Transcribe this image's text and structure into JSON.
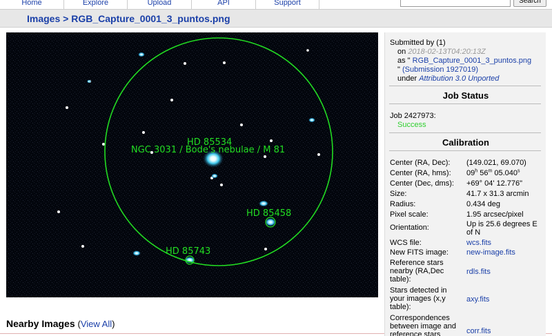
{
  "nav": {
    "home": "Home",
    "explore": "Explore",
    "upload": "Upload",
    "api": "API",
    "support": "Support",
    "search_button": "Search"
  },
  "breadcrumb": {
    "root": "Images",
    "separator": ">",
    "current": "RGB_Capture_0001_3_puntos.png"
  },
  "image": {
    "annotations": {
      "hd85534": "HD 85534",
      "ngc3031": "NGC 3031 / Bode's nebulae / M 81",
      "hd85458": "HD 85458",
      "hd85743": "HD 85743"
    },
    "annotation_color": "#22dd22"
  },
  "submission": {
    "submitted_by": "Submitted by (1)",
    "on_label": "on",
    "date": "2018-02-13T04:20:13Z",
    "as_prefix": "as \"",
    "filename": "RGB_Capture_0001_3_puntos.png",
    "quote_close": "\"",
    "submission_link": "(Submission 1927019)",
    "under_label": "under",
    "license": "Attribution 3.0 Unported"
  },
  "job_status": {
    "title": "Job Status",
    "job_label": "Job 2427973:",
    "status": "Success"
  },
  "calibration": {
    "title": "Calibration",
    "center_radec_label": "Center (RA, Dec):",
    "center_radec_value": "(149.021, 69.070)",
    "center_hms_label": "Center (RA, hms):",
    "ra_h": "09",
    "ra_m": "56",
    "ra_s": "05.040",
    "center_dms_label": "Center (Dec, dms):",
    "center_dms_value": "+69° 04' 12.776\"",
    "size_label": "Size:",
    "size_value": "41.7 x 31.3 arcmin",
    "radius_label": "Radius:",
    "radius_value": "0.434 deg",
    "pixel_scale_label": "Pixel scale:",
    "pixel_scale_value": "1.95 arcsec/pixel",
    "orientation_label": "Orientation:",
    "orientation_value": "Up is 25.6 degrees E of N",
    "wcs_label": "WCS file:",
    "wcs_value": "wcs.fits",
    "new_fits_label": "New FITS image:",
    "new_fits_value": "new-image.fits",
    "ref_stars_label": "Reference stars nearby (RA,Dec table):",
    "ref_stars_value": "rdls.fits",
    "detected_label": "Stars detected in your images (x,y table):",
    "detected_value": "axy.fits",
    "corr_label": "Correspondences between image and reference stars",
    "corr_value": "corr.fits"
  },
  "nearby": {
    "title": "Nearby Images",
    "view_all_open": "(",
    "view_all": "View All",
    "view_all_close": ")"
  }
}
